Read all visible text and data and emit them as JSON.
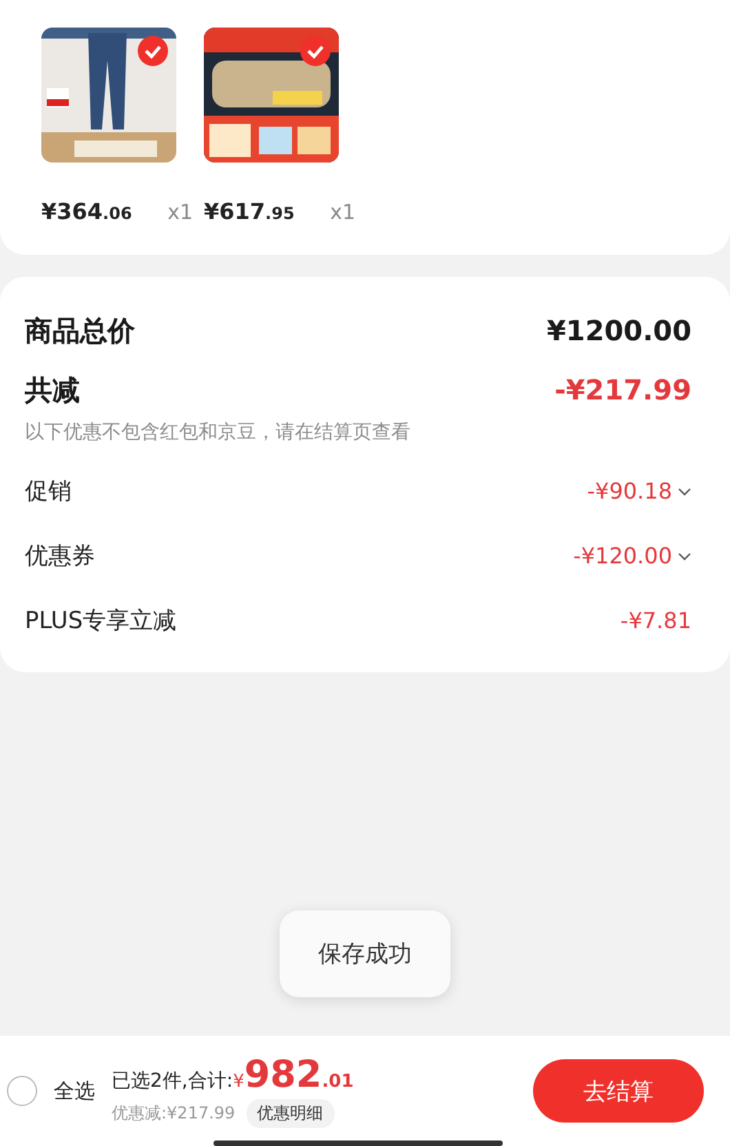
{
  "products": [
    {
      "kind": "picture",
      "selected": true,
      "price_main": "¥364",
      "price_decimal": ".06",
      "quantity": "x1"
    },
    {
      "kind": "picture",
      "selected": true,
      "price_main": "¥617",
      "price_decimal": ".95",
      "quantity": "x1"
    }
  ],
  "summary": {
    "total_label": "商品总价",
    "total_value": "¥1200.00",
    "reduction_label": "共减",
    "reduction_value": "-¥217.99",
    "note": "以下优惠不包含红包和京豆，请在结算页查看",
    "rows": [
      {
        "label": "促销",
        "value": "-¥90.18",
        "expandable": true
      },
      {
        "label": "优惠券",
        "value": "-¥120.00",
        "expandable": true
      },
      {
        "label": "PLUS专享立减",
        "value": "-¥7.81",
        "expandable": false
      }
    ]
  },
  "toast": "保存成功",
  "footer": {
    "select_all_checked": false,
    "select_all": "全选",
    "selected_text": "已选2件,合计:",
    "currency": "¥",
    "total_main": "982",
    "total_decimal": ".01",
    "discount": "优惠减:¥217.99",
    "detail_button": "优惠明细",
    "checkout": "去结算"
  }
}
